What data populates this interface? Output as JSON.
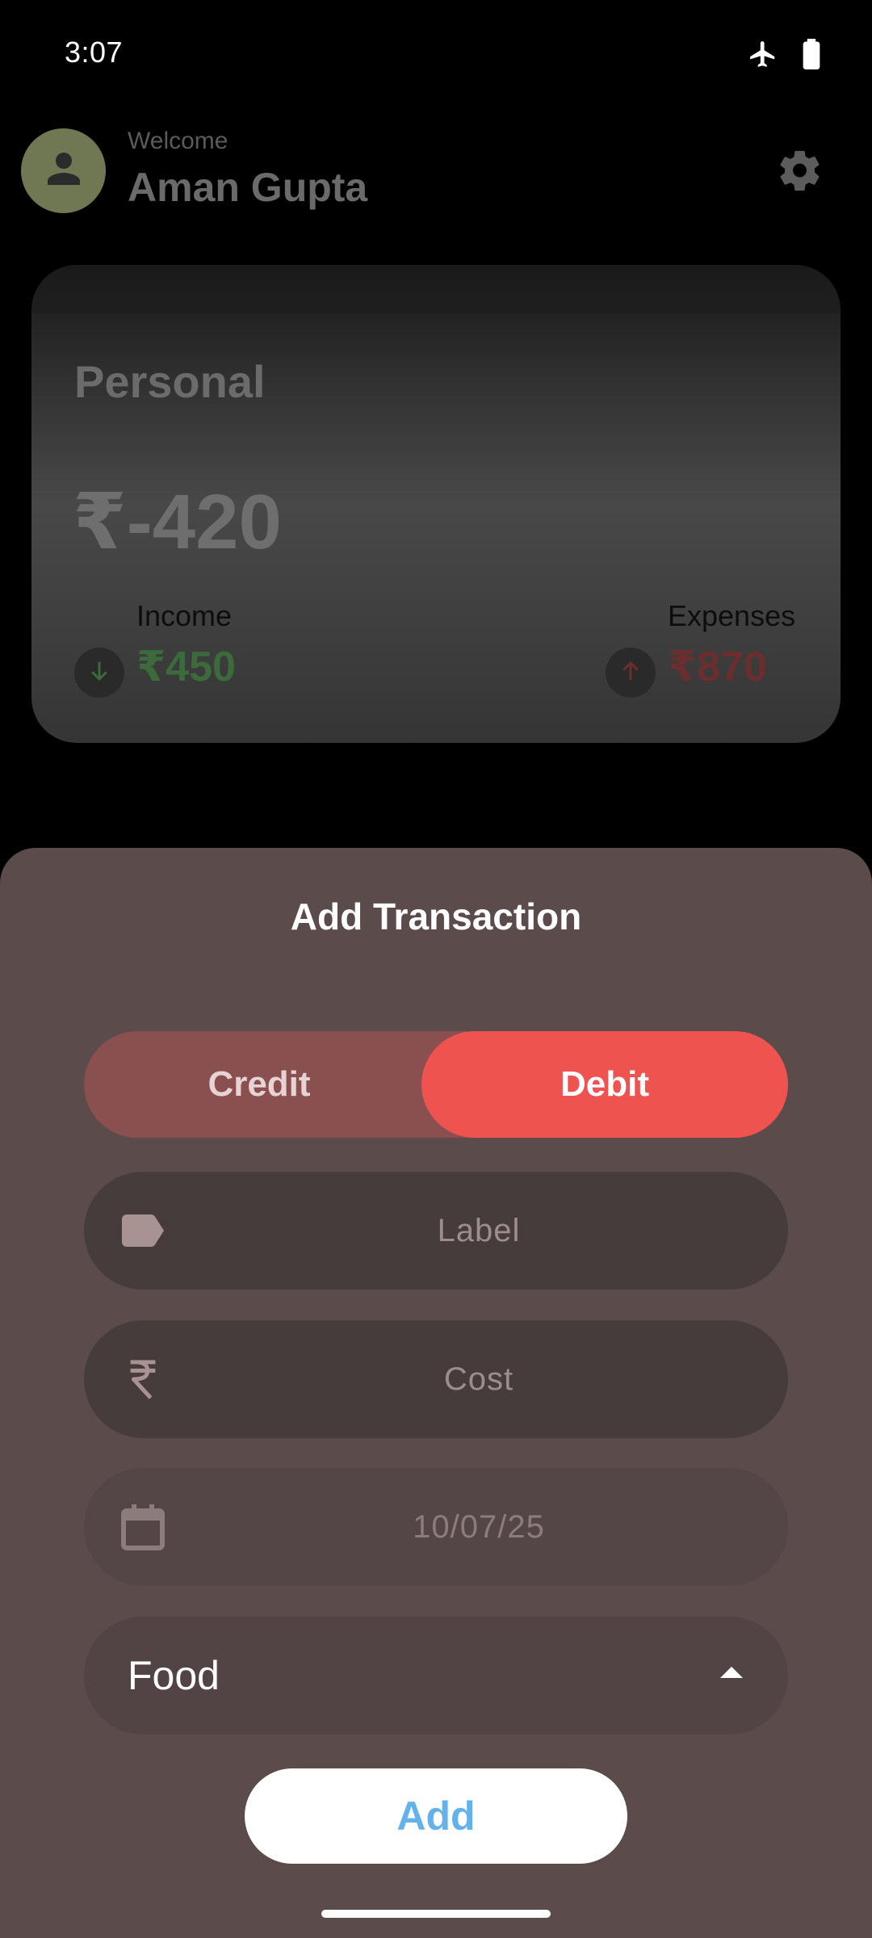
{
  "status_bar": {
    "time": "3:07",
    "icons": [
      "airplane-mode-icon",
      "battery-icon"
    ]
  },
  "header": {
    "welcome": "Welcome",
    "user_name": "Aman Gupta",
    "avatar_icon": "person-icon",
    "settings_icon": "gear-icon"
  },
  "card": {
    "title": "Personal",
    "balance": "₹-420",
    "income": {
      "label": "Income",
      "value": "₹450",
      "icon": "arrow-down-icon",
      "color": "#3b6a3b"
    },
    "expenses": {
      "label": "Expenses",
      "value": "₹870",
      "icon": "arrow-up-icon",
      "color": "#6a2e2e"
    }
  },
  "sheet": {
    "title": "Add Transaction",
    "toggle": {
      "credit_label": "Credit",
      "debit_label": "Debit",
      "selected": "Debit"
    },
    "label_field": {
      "placeholder": "Label",
      "icon": "tag-icon"
    },
    "cost_field": {
      "placeholder": "Cost",
      "icon": "rupee-icon"
    },
    "date_field": {
      "value": "10/07/25",
      "icon": "calendar-icon"
    },
    "category": {
      "value": "Food",
      "icon": "arrow-up-dropdown-icon"
    },
    "add_button": "Add"
  },
  "colors": {
    "accent_debit": "#ef5350",
    "credit_inactive": "#8a4f4f",
    "sheet_bg": "#5b4b4b",
    "add_text": "#64b2ec"
  }
}
